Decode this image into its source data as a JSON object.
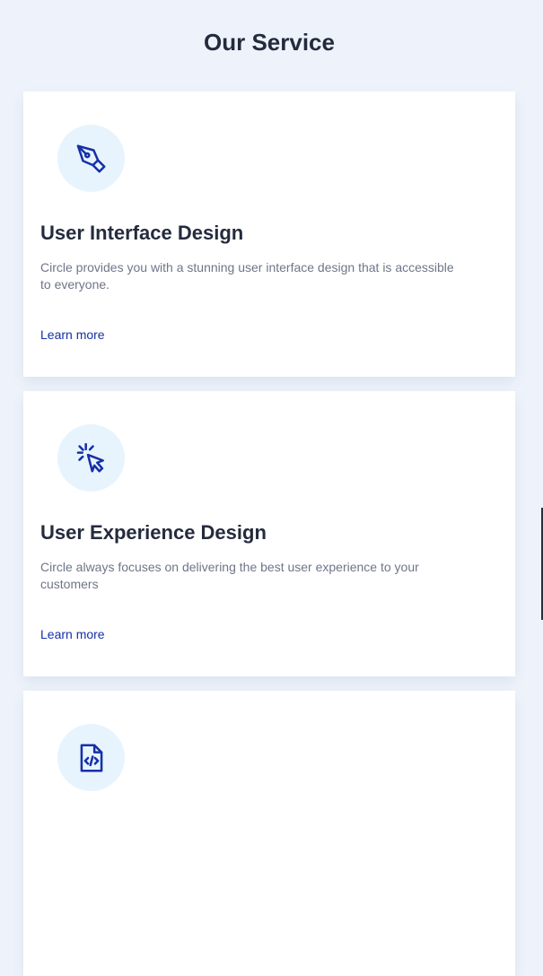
{
  "section": {
    "title": "Our Service"
  },
  "services": [
    {
      "icon": "pen-tool-icon",
      "title": "User Interface Design",
      "description": "Circle provides you with a stunning user interface design that is accessible to everyone.",
      "link_label": "Learn more"
    },
    {
      "icon": "cursor-click-icon",
      "title": "User Experience Design",
      "description": "Circle always focuses on delivering the best user experience to your customers",
      "link_label": "Learn more"
    },
    {
      "icon": "code-file-icon"
    }
  ],
  "colors": {
    "background": "#eef3fb",
    "card": "#ffffff",
    "icon_circle": "#e8f4fd",
    "accent": "#1630a8",
    "heading": "#242b3d",
    "body_text": "#6f7688"
  }
}
